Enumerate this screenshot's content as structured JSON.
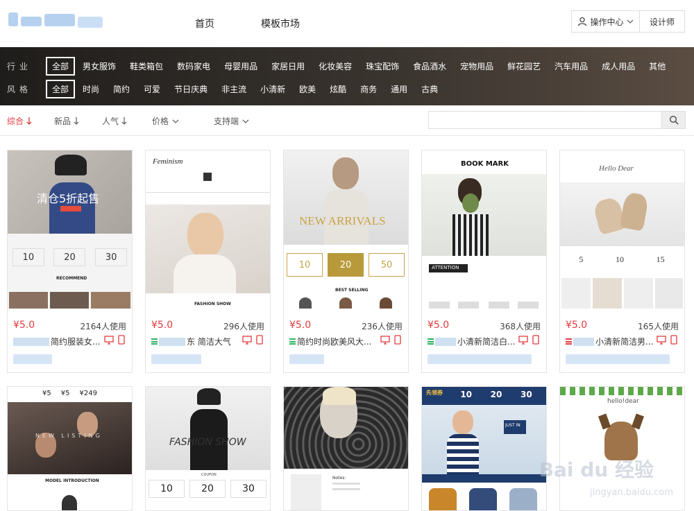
{
  "header": {
    "nav": [
      "首页",
      "模板市场"
    ],
    "user_menu": "操作中心",
    "designer": "设计师"
  },
  "filters": {
    "industry_label": "行业",
    "industry": [
      "全部",
      "男女服饰",
      "鞋类箱包",
      "数码家电",
      "母婴用品",
      "家居日用",
      "化妆美容",
      "珠宝配饰",
      "食品酒水",
      "宠物用品",
      "鲜花园艺",
      "汽车用品",
      "成人用品",
      "其他"
    ],
    "style_label": "风格",
    "style": [
      "全部",
      "时尚",
      "简约",
      "可爱",
      "节日庆典",
      "非主流",
      "小清新",
      "欧美",
      "炫酷",
      "商务",
      "通用",
      "古典"
    ],
    "active_index": 0
  },
  "sort": {
    "items": [
      {
        "label": "综合",
        "icon": "arrow-down",
        "active": true
      },
      {
        "label": "新品",
        "icon": "arrow-down",
        "active": false
      },
      {
        "label": "人气",
        "icon": "arrow-down",
        "active": false
      },
      {
        "label": "价格",
        "icon": "chevron-down",
        "active": false
      },
      {
        "label": "支持端",
        "icon": "chevron-down",
        "active": false
      }
    ],
    "search_placeholder": ""
  },
  "cards": [
    {
      "price": "¥5.0",
      "uses": "2164人使用",
      "name": "简约服装女...",
      "thumb_text": "清仓5折起售",
      "sub1": "RECOMMEND",
      "coupons": [
        "10",
        "20",
        "30"
      ]
    },
    {
      "price": "¥5.0",
      "uses": "296人使用",
      "name": "东 简洁大气",
      "thumb_text": "Feminism",
      "sub1": "FASHION SHOW",
      "coupons": []
    },
    {
      "price": "¥5.0",
      "uses": "236人使用",
      "name": "简约时尚欧美风大...",
      "thumb_text": "NEW ARRIVALS",
      "sub1": "BEST SELLING",
      "coupons": [
        "10",
        "20",
        "50"
      ]
    },
    {
      "price": "¥5.0",
      "uses": "368人使用",
      "name": "小清新简洁白...",
      "thumb_text": "BOOK MARK",
      "sub1": "ATTENTION",
      "coupons": []
    },
    {
      "price": "¥5.0",
      "uses": "165人使用",
      "name": "小清新简洁男...",
      "thumb_text": "Hello Dear",
      "sub1": "",
      "coupons": [
        "5",
        "10",
        "15"
      ]
    },
    {
      "price": "",
      "uses": "",
      "name": "",
      "thumb_text": "NEW LISTING",
      "sub1": "MODEL INTRODUCTION",
      "coupons": [
        "¥5",
        "¥5",
        "¥249"
      ]
    },
    {
      "price": "",
      "uses": "",
      "name": "",
      "thumb_text": "FASHION SHOW",
      "sub1": "COUPON",
      "coupons": [
        "10",
        "20",
        "30"
      ]
    },
    {
      "price": "",
      "uses": "",
      "name": "",
      "thumb_text": "",
      "sub1": "Notes:",
      "coupons": []
    },
    {
      "price": "",
      "uses": "",
      "name": "",
      "thumb_text": "先领券",
      "sub1": "JUST IN",
      "coupons": [
        "10",
        "20",
        "30"
      ]
    },
    {
      "price": "",
      "uses": "",
      "name": "",
      "thumb_text": "hello!dear",
      "sub1": "",
      "coupons": []
    }
  ],
  "watermark": {
    "main": "Bai du 经验",
    "sub": "jingyan.baidu.com"
  }
}
